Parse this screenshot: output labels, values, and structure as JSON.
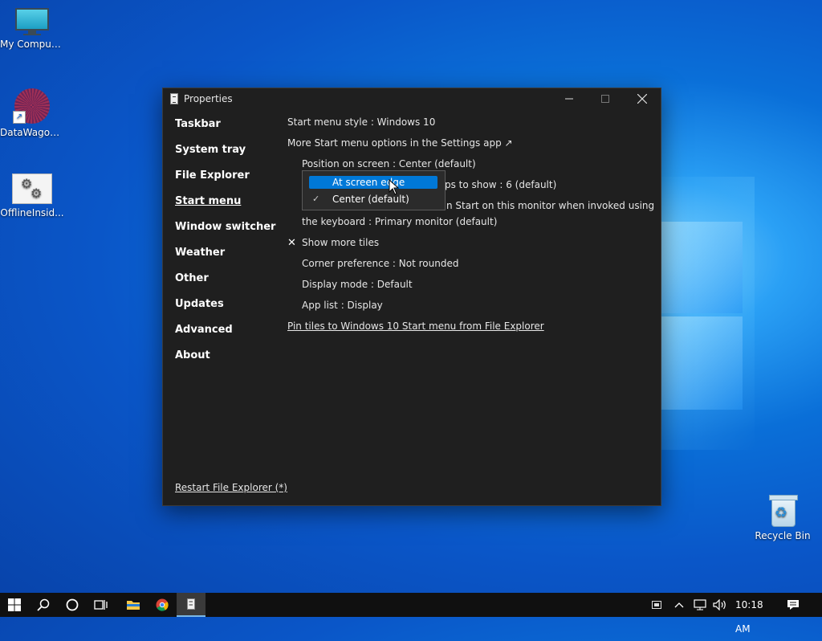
{
  "desktop": {
    "icons": [
      {
        "label": "My Computer"
      },
      {
        "label": "DataWagon..."
      },
      {
        "label": "OfflineInsid..."
      },
      {
        "label": "Recycle Bin"
      }
    ]
  },
  "window": {
    "title": "Properties",
    "nav": [
      "Taskbar",
      "System tray",
      "File Explorer",
      "Start menu",
      "Window switcher",
      "Weather",
      "Other",
      "Updates",
      "Advanced",
      "About"
    ],
    "active_nav": "Start menu",
    "content": {
      "start_menu_style": "Start menu style : Windows 10",
      "more_options": "More Start menu options in the Settings app ↗",
      "position": "Position on screen : Center (default)",
      "apps_to_show_partial": "ps to show : 6 (default)",
      "monitor_line1_partial": "n Start on this monitor when invoked using",
      "monitor_line2": "the keyboard : Primary monitor (default)",
      "show_more_tiles": "Show more tiles",
      "corner_pref": "Corner preference : Not rounded",
      "display_mode": "Display mode : Default",
      "app_list": "App list : Display",
      "pin_tiles": "Pin tiles to Windows 10 Start menu from File Explorer"
    },
    "dropdown": {
      "options": [
        "At screen edge",
        "Center (default)"
      ]
    },
    "restart": "Restart File Explorer (*)"
  },
  "taskbar": {
    "clock": "10:18 AM"
  },
  "colors": {
    "accent": "#0078d7",
    "window_bg": "#1f1f1f",
    "taskbar_bg": "#101010"
  }
}
